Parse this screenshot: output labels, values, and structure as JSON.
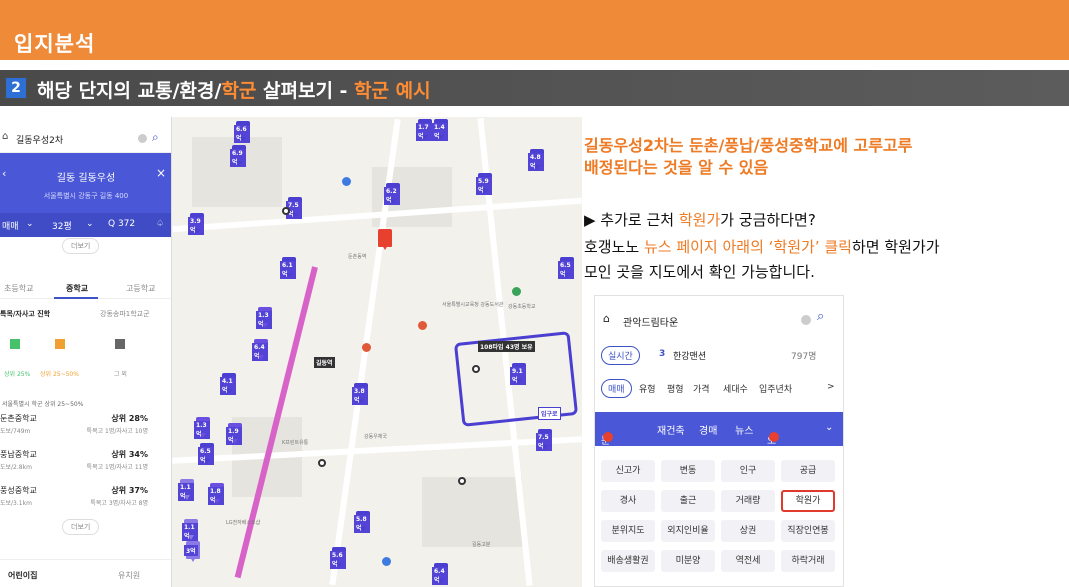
{
  "header": {
    "title": "입지분석"
  },
  "section": {
    "num": "2",
    "part1": "해당 단지의 교통/환경/",
    "part2": "학군",
    "part3": " 살펴보기 - ",
    "part4": "학군 예시"
  },
  "left_app": {
    "search_query": "길동우성2차",
    "complex_name": "길동 길동우성",
    "address": "서울특별시 강동구 길동 400",
    "filter_left": "매매",
    "filter_size": "32평",
    "filter_count": "Q 372",
    "more": "더보기",
    "school_tabs": [
      "초등학교",
      "중학교",
      "고등학교"
    ],
    "track_label": "특목/자사고 진학",
    "track_region": "강동송파1학교군",
    "pct_labels": [
      "상위 25%",
      "상위 25~50%",
      "그 외"
    ],
    "region_note": "서울특별시 학군 상위 25~50%",
    "schools": [
      {
        "name": "둔촌중학교",
        "rank": "상위 28%",
        "dist": "도보/749m",
        "stat": "특목고 1명/자사고 10명"
      },
      {
        "name": "풍납중학교",
        "rank": "상위 34%",
        "dist": "도보/2.8km",
        "stat": "특목고 1명/자사고 11명"
      },
      {
        "name": "풍성중학교",
        "rank": "상위 37%",
        "dist": "도보/3.1km",
        "stat": "특목고 3명/자사고 8명"
      }
    ],
    "bottom_tabs": [
      "어린이집",
      "유치원"
    ]
  },
  "map": {
    "pins": [
      {
        "label": "6.6억"
      },
      {
        "label": "6.9억"
      },
      {
        "label": "7.5억"
      },
      {
        "label": "6.2억"
      },
      {
        "label": "1.4억"
      },
      {
        "label": "1.7억"
      },
      {
        "label": "4.8억"
      },
      {
        "label": "5.9억"
      },
      {
        "label": "3.9억"
      },
      {
        "label": "6.1억"
      },
      {
        "label": "6.5억"
      },
      {
        "label": "1.3억"
      },
      {
        "label": "6.4억"
      },
      {
        "label": "4.1억"
      },
      {
        "label": "3.8억"
      },
      {
        "label": "9.1억"
      },
      {
        "label": "7.5억"
      },
      {
        "label": "1.3억"
      },
      {
        "label": "1.9억"
      },
      {
        "label": "6.5억"
      },
      {
        "label": "1.1억"
      },
      {
        "label": "1.8억"
      },
      {
        "label": "5.8억"
      },
      {
        "label": "5.6억"
      },
      {
        "label": "6.4억"
      },
      {
        "label": "1.1억"
      },
      {
        "label": "3억"
      }
    ],
    "complex_tag": "108타입 43명 보유",
    "entrance": "입구로",
    "station": "길동역",
    "labels": [
      "둔촌동역",
      "서울특별시교육청 강동도서관",
      "강동우체국",
      "LG전자베스트샵",
      "K프린트유통",
      "길동고분",
      "강동초등학교"
    ]
  },
  "right": {
    "line1": "길동우성2차는 둔촌/풍납/풍성중학교에 고루고루",
    "line2": "배정된다는 것을 알 수 있음",
    "p1_a": "▶ 추가로 근처 ",
    "p1_b": "학원가",
    "p1_c": "가 궁금하다면?",
    "p2_a": "호갱노노 ",
    "p2_b": "뉴스 페이지 아래의 ‘학원가’ 클릭",
    "p2_c": "하면 학원가가",
    "p3": "모인 곳을 지도에서 확인 가능합니다."
  },
  "right_app": {
    "search_query": "관악드림타운",
    "trend": "실시간",
    "rank_num": "3",
    "rank_name": "한강맨션",
    "rank_count": "797명",
    "filters": [
      "매매",
      "유형",
      "평형",
      "가격",
      "세대수",
      "입주년차",
      ">"
    ],
    "tabs": [
      "분양",
      "재건축",
      "경매",
      "뉴스",
      "오늘"
    ],
    "grid": [
      [
        "신고가",
        "변동",
        "인구",
        "공급"
      ],
      [
        "경사",
        "출근",
        "거래량",
        "학원가"
      ],
      [
        "분위지도",
        "외지인비율",
        "상권",
        "직장인연봉"
      ],
      [
        "배송생활권",
        "미분양",
        "역전세",
        "하락거래"
      ]
    ]
  }
}
